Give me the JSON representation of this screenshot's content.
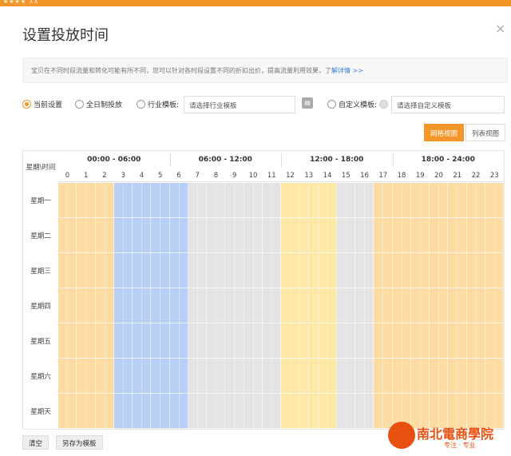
{
  "header": {
    "topbar_text": "★★★★ ∧∧"
  },
  "dialog": {
    "title": "设置投放时间",
    "close_glyph": "×"
  },
  "notice": {
    "text": "宝贝在不同时段流量和转化可能有所不同，您可以针对各时段设置不同的折扣出价，提高流量利用效果，了",
    "link": "解详情 >>"
  },
  "options": {
    "current": "当前设置",
    "all_day": "全日制投放",
    "industry": "行业模板:",
    "industry_placeholder": "请选择行业模板",
    "custom": "自定义模板:",
    "custom_placeholder": "请选择自定义模板"
  },
  "view": {
    "grid": "网格视图",
    "list": "列表视图"
  },
  "grid": {
    "corner": "星期\\时间",
    "ranges": [
      "00:00 - 06:00",
      "06:00 - 12:00",
      "12:00 - 18:00",
      "18:00 - 24:00"
    ],
    "hours": [
      "0",
      "1",
      "2",
      "3",
      "4",
      "5",
      "6",
      "7",
      "8",
      "9",
      "10",
      "11",
      "12",
      "13",
      "14",
      "15",
      "16",
      "17",
      "18",
      "19",
      "20",
      "21",
      "22",
      "23"
    ],
    "days": [
      "星期一",
      "星期二",
      "星期三",
      "星期四",
      "星期五",
      "星期六",
      "星期天"
    ],
    "hour_levels": [
      "orange",
      "orange",
      "orange",
      "blue",
      "blue",
      "blue",
      "blue",
      "gray",
      "gray",
      "gray",
      "gray",
      "gray",
      "yellow",
      "yellow",
      "yellow",
      "gray",
      "gray",
      "orange",
      "orange",
      "orange",
      "orange",
      "orange",
      "orange",
      "orange"
    ],
    "colors": {
      "orange": "#fddca3",
      "blue": "#b8d0f5",
      "gray": "#e4e4e4",
      "yellow": "#fde8a8"
    }
  },
  "footer": {
    "clear": "清空",
    "save_as": "另存为模板"
  },
  "watermark": {
    "text": "南北電商學院",
    "sub": "专注 · 专业"
  }
}
